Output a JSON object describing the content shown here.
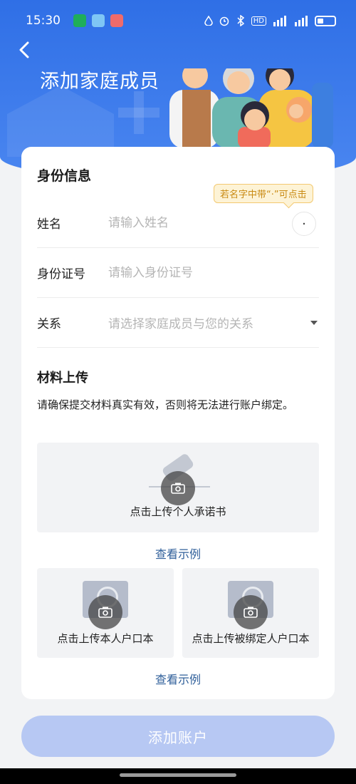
{
  "status_bar": {
    "time": "15:30",
    "right_indicators": [
      "alarm-icon",
      "bluetooth-icon",
      "HD",
      "4G",
      "5G",
      "battery-icon"
    ]
  },
  "header": {
    "title": "添加家庭成员"
  },
  "identity": {
    "section_title": "身份信息",
    "tooltip": "若名字中带“·”可点击",
    "dot_button": "·",
    "fields": [
      {
        "label": "姓名",
        "placeholder": "请输入姓名"
      },
      {
        "label": "身份证号",
        "placeholder": "请输入身份证号"
      },
      {
        "label": "关系",
        "placeholder": "请选择家庭成员与您的关系"
      }
    ]
  },
  "materials": {
    "section_title": "材料上传",
    "notice": "请确保提交材料真实有效，否则将无法进行账户绑定。",
    "upload_commitment_label": "点击上传个人承诺书",
    "view_example_1": "查看示例",
    "upload_own_hukou_label": "点击上传本人户口本",
    "upload_bound_hukou_label": "点击上传被绑定人户口本",
    "view_example_2": "查看示例"
  },
  "submit": {
    "label": "添加账户"
  },
  "colors": {
    "header_blue": "#2f6fe6",
    "submit_disabled": "#b7c8f3",
    "link": "#2f5f9a",
    "tooltip_bg": "#fdf3d6",
    "tooltip_text": "#c98a12"
  }
}
